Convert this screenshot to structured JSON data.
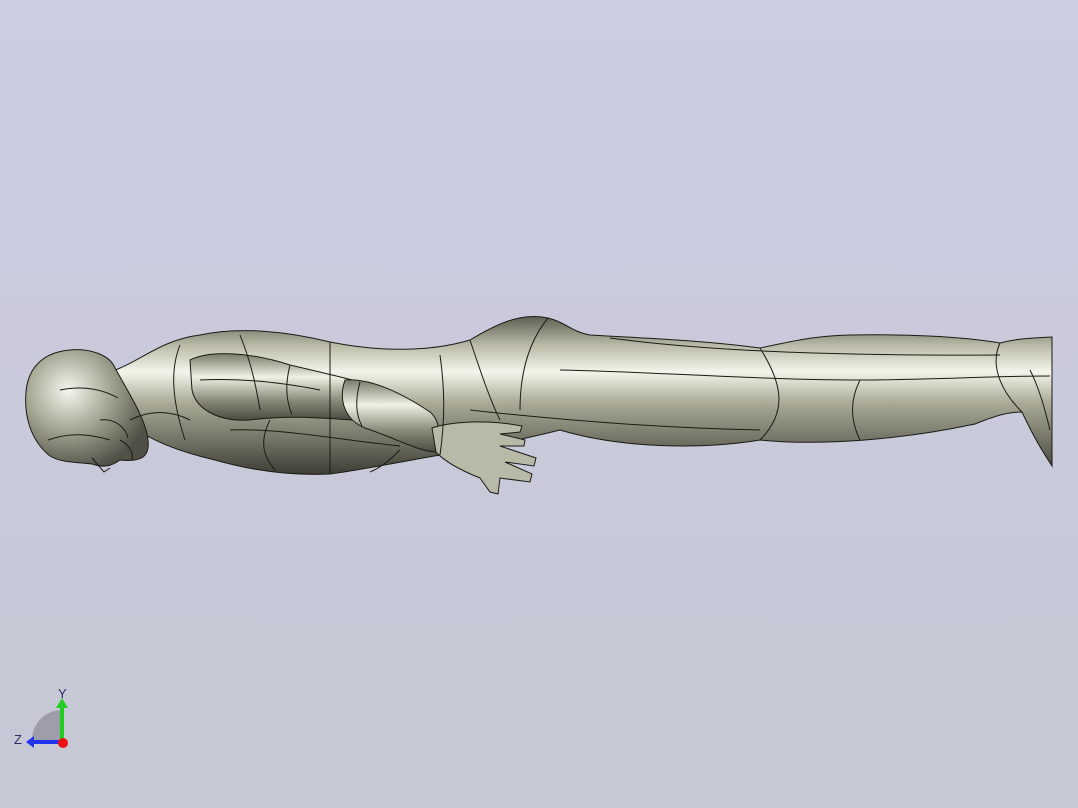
{
  "viewport": {
    "background_top": "#ccccE2",
    "background_bottom": "#c6c8d4",
    "model": {
      "name": "human-body-model",
      "surface_color": "#9a9a86",
      "edge_color": "#1a1a14"
    }
  },
  "triad": {
    "y_label": "Y",
    "z_label": "Z",
    "y_color": "#22cc22",
    "z_color": "#2233ee",
    "x_color": "#ee1111"
  }
}
